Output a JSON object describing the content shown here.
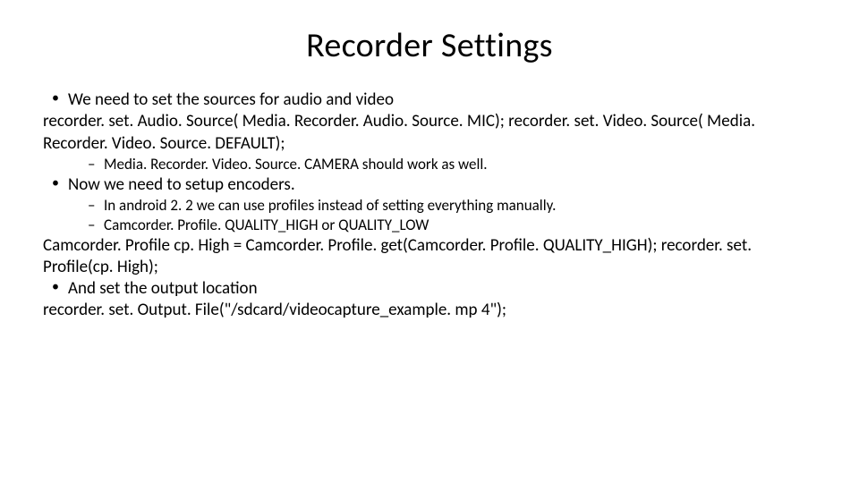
{
  "title": "Recorder Settings",
  "lines": {
    "a": "We need to set the sources for audio and video",
    "b": "recorder. set. Audio. Source( Media. Recorder. Audio. Source. MIC);    recorder. set. Video. Source( Media. Recorder. Video. Source. DEFAULT);",
    "c": "Media. Recorder. Video. Source. CAMERA should work as well.",
    "d": "Now we need to setup encoders.",
    "e": "In android 2. 2 we can use profiles instead of setting everything manually.",
    "f": "Camcorder. Profile. QUALITY_HIGH  or QUALITY_LOW",
    "g": "Camcorder. Profile cp. High = Camcorder. Profile. get(Camcorder. Profile. QUALITY_HIGH); recorder. set. Profile(cp. High);",
    "h": "And set the output location",
    "i": "recorder. set. Output. File(\"/sdcard/videocapture_example. mp 4\");"
  }
}
